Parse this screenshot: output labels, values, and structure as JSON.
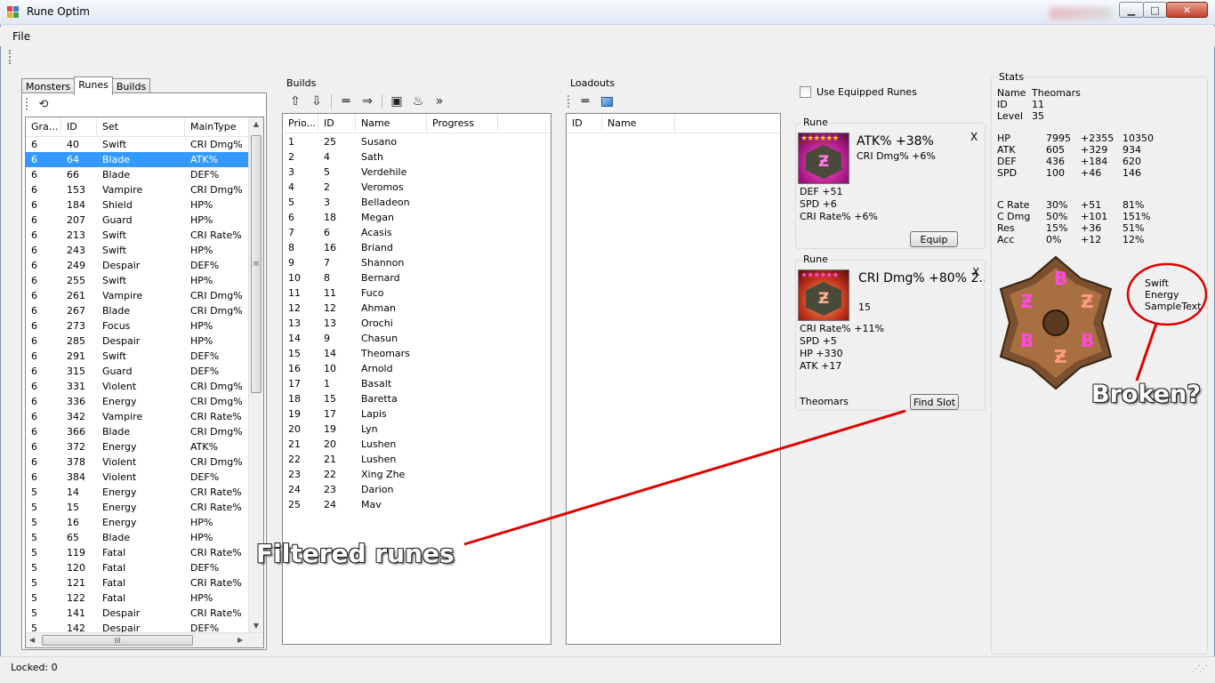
{
  "window": {
    "title": "Rune Optim",
    "minimize": "▁",
    "maximize": "□",
    "close": "✕"
  },
  "menu": {
    "file": "File"
  },
  "left": {
    "tabs": [
      "Monsters",
      "Runes",
      "Builds"
    ],
    "active_tab": "Runes",
    "columns": [
      "Gra...",
      "ID",
      "Set",
      "MainType"
    ],
    "rows": [
      [
        "6",
        "40",
        "Swift",
        "CRI Dmg%"
      ],
      [
        "6",
        "64",
        "Blade",
        "ATK%"
      ],
      [
        "6",
        "66",
        "Blade",
        "DEF%"
      ],
      [
        "6",
        "153",
        "Vampire",
        "CRI Dmg%"
      ],
      [
        "6",
        "184",
        "Shield",
        "HP%"
      ],
      [
        "6",
        "207",
        "Guard",
        "HP%"
      ],
      [
        "6",
        "213",
        "Swift",
        "CRI Rate%"
      ],
      [
        "6",
        "243",
        "Swift",
        "HP%"
      ],
      [
        "6",
        "249",
        "Despair",
        "DEF%"
      ],
      [
        "6",
        "255",
        "Swift",
        "HP%"
      ],
      [
        "6",
        "261",
        "Vampire",
        "CRI Dmg%"
      ],
      [
        "6",
        "267",
        "Blade",
        "CRI Dmg%"
      ],
      [
        "6",
        "273",
        "Focus",
        "HP%"
      ],
      [
        "6",
        "285",
        "Despair",
        "HP%"
      ],
      [
        "6",
        "291",
        "Swift",
        "DEF%"
      ],
      [
        "6",
        "315",
        "Guard",
        "DEF%"
      ],
      [
        "6",
        "331",
        "Violent",
        "CRI Dmg%"
      ],
      [
        "6",
        "336",
        "Energy",
        "CRI Dmg%"
      ],
      [
        "6",
        "342",
        "Vampire",
        "CRI Rate%"
      ],
      [
        "6",
        "366",
        "Blade",
        "CRI Dmg%"
      ],
      [
        "6",
        "372",
        "Energy",
        "ATK%"
      ],
      [
        "6",
        "378",
        "Violent",
        "CRI Dmg%"
      ],
      [
        "6",
        "384",
        "Violent",
        "DEF%"
      ],
      [
        "5",
        "14",
        "Energy",
        "CRI Rate%"
      ],
      [
        "5",
        "15",
        "Energy",
        "CRI Rate%"
      ],
      [
        "5",
        "16",
        "Energy",
        "HP%"
      ],
      [
        "5",
        "65",
        "Blade",
        "HP%"
      ],
      [
        "5",
        "119",
        "Fatal",
        "CRI Rate%"
      ],
      [
        "5",
        "120",
        "Fatal",
        "DEF%"
      ],
      [
        "5",
        "121",
        "Fatal",
        "CRI Rate%"
      ],
      [
        "5",
        "122",
        "Fatal",
        "HP%"
      ],
      [
        "5",
        "141",
        "Despair",
        "CRI Rate%"
      ],
      [
        "5",
        "142",
        "Despair",
        "DEF%"
      ]
    ],
    "selected_id": "64",
    "hscroll_thumb": "III"
  },
  "builds": {
    "title": "Builds",
    "columns": [
      "Prio...",
      "ID",
      "Name",
      "Progress"
    ],
    "rows": [
      [
        "1",
        "25",
        "Susano"
      ],
      [
        "2",
        "4",
        "Sath"
      ],
      [
        "3",
        "5",
        "Verdehile"
      ],
      [
        "4",
        "2",
        "Veromos"
      ],
      [
        "5",
        "3",
        "Belladeon"
      ],
      [
        "6",
        "18",
        "Megan"
      ],
      [
        "7",
        "6",
        "Acasis"
      ],
      [
        "8",
        "16",
        "Briand"
      ],
      [
        "9",
        "7",
        "Shannon"
      ],
      [
        "10",
        "8",
        "Bernard"
      ],
      [
        "11",
        "11",
        "Fuco"
      ],
      [
        "12",
        "12",
        "Ahman"
      ],
      [
        "13",
        "13",
        "Orochi"
      ],
      [
        "14",
        "9",
        "Chasun"
      ],
      [
        "15",
        "14",
        "Theomars"
      ],
      [
        "16",
        "10",
        "Arnold"
      ],
      [
        "17",
        "1",
        "Basalt"
      ],
      [
        "18",
        "15",
        "Baretta"
      ],
      [
        "19",
        "17",
        "Lapis"
      ],
      [
        "20",
        "19",
        "Lyn"
      ],
      [
        "21",
        "20",
        "Lushen"
      ],
      [
        "22",
        "21",
        "Lushen"
      ],
      [
        "23",
        "22",
        "Xing Zhe"
      ],
      [
        "24",
        "23",
        "Darion"
      ],
      [
        "25",
        "24",
        "Mav"
      ]
    ]
  },
  "loadouts": {
    "title": "Loadouts",
    "columns": [
      "ID",
      "Name"
    ]
  },
  "options": {
    "use_equipped": "Use Equipped Runes"
  },
  "rune1": {
    "title": "Rune",
    "main": "ATK% +38%",
    "innate": "CRI Dmg% +6%",
    "subs": [
      "DEF +51",
      "SPD +6",
      "CRI Rate% +6%"
    ],
    "close": "X",
    "button": "Equip",
    "stars": "★★★★★★",
    "glyph": "Ƶ"
  },
  "rune2": {
    "title": "Rune",
    "main": "CRI Dmg% +80% 2…",
    "level": "15",
    "subs": [
      "CRI Rate% +11%",
      "SPD +5",
      "HP +330",
      "ATK +17"
    ],
    "close": "X",
    "monster": "Theomars",
    "button": "Find Slot",
    "stars": "★★★★★★",
    "glyph": "Ƶ"
  },
  "stats": {
    "title": "Stats",
    "info": [
      [
        "Name",
        "Theomars"
      ],
      [
        "ID",
        "11"
      ],
      [
        "Level",
        "35"
      ]
    ],
    "base": [
      [
        "HP",
        "7995",
        "+2355",
        "10350"
      ],
      [
        "ATK",
        "605",
        "+329",
        "934"
      ],
      [
        "DEF",
        "436",
        "+184",
        "620"
      ],
      [
        "SPD",
        "100",
        "+46",
        "146"
      ]
    ],
    "extra": [
      [
        "C Rate",
        "30%",
        "+51",
        "81%"
      ],
      [
        "C Dmg",
        "50%",
        "+101",
        "151%"
      ],
      [
        "Res",
        "15%",
        "+36",
        "51%"
      ],
      [
        "Acc",
        "0%",
        "+12",
        "12%"
      ]
    ],
    "sets": [
      "Swift",
      "Energy",
      "SampleText"
    ],
    "wheel_glyphs": [
      "B",
      "Ƶ",
      "Ƶ",
      "B",
      "B",
      "Ƶ"
    ]
  },
  "annotations": {
    "filtered": "Filtered runes",
    "broken": "Broken?"
  },
  "status": {
    "locked": "Locked: 0"
  },
  "colors": {
    "selection": "#3399ff",
    "annotation": "#e00000"
  }
}
